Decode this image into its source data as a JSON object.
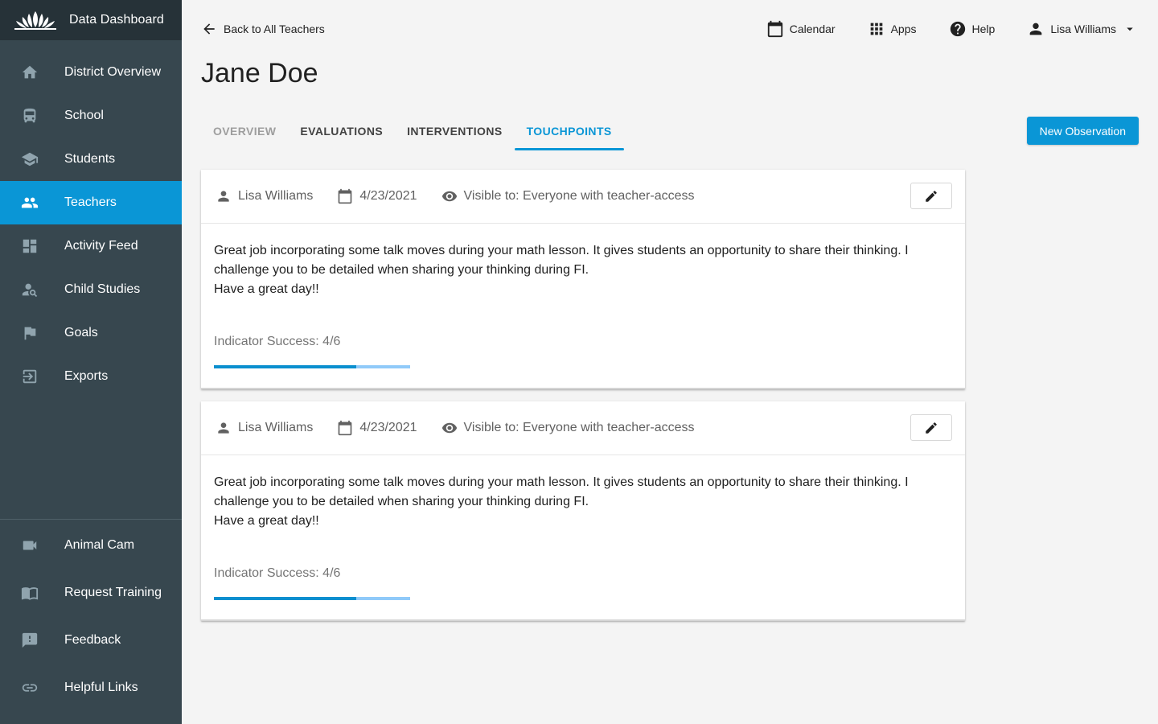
{
  "app": {
    "title": "Data Dashboard"
  },
  "sidebar": {
    "items": [
      {
        "label": "District Overview",
        "icon": "home-icon"
      },
      {
        "label": "School",
        "icon": "bus-icon"
      },
      {
        "label": "Students",
        "icon": "graduation-cap-icon"
      },
      {
        "label": "Teachers",
        "icon": "people-icon",
        "active": true
      },
      {
        "label": "Activity Feed",
        "icon": "dashboard-icon"
      },
      {
        "label": "Child Studies",
        "icon": "person-search-icon"
      },
      {
        "label": "Goals",
        "icon": "flag-icon"
      },
      {
        "label": "Exports",
        "icon": "exit-icon"
      }
    ],
    "bottom_items": [
      {
        "label": "Animal Cam",
        "icon": "video-camera-icon"
      },
      {
        "label": "Request Training",
        "icon": "book-icon"
      },
      {
        "label": "Feedback",
        "icon": "feedback-icon"
      },
      {
        "label": "Helpful Links",
        "icon": "link-icon"
      }
    ]
  },
  "header": {
    "back_label": "Back to All Teachers",
    "calendar_label": "Calendar",
    "apps_label": "Apps",
    "help_label": "Help",
    "user_name": "Lisa Williams"
  },
  "page": {
    "title": "Jane Doe",
    "tabs": [
      {
        "label": "OVERVIEW",
        "state": "muted"
      },
      {
        "label": "EVALUATIONS",
        "state": "normal"
      },
      {
        "label": "INTERVENTIONS",
        "state": "normal"
      },
      {
        "label": "TOUCHPOINTS",
        "state": "active"
      }
    ],
    "new_observation_label": "New Observation"
  },
  "touchpoints": [
    {
      "author": "Lisa Williams",
      "date": "4/23/2021",
      "visibility": "Visible to: Everyone with teacher-access",
      "body_line1": "Great job incorporating some talk moves during your math lesson. It gives students an opportunity to share their thinking. I",
      "body_line2": "challenge you to be detailed when sharing your thinking during FI.",
      "body_line3": "Have a great day!!",
      "indicator_label": "Indicator Success: 4/6",
      "indicator_progress": 0.7246
    },
    {
      "author": "Lisa Williams",
      "date": "4/23/2021",
      "visibility": "Visible to: Everyone with teacher-access",
      "body_line1": "Great job incorporating some talk moves during your math lesson. It gives students an opportunity to share their thinking. I",
      "body_line2": "challenge you to be detailed when sharing your thinking during FI.",
      "body_line3": "Have a great day!!",
      "indicator_label": "Indicator Success: 4/6",
      "indicator_progress": 0.7246
    }
  ],
  "colors": {
    "accent": "#0a96d6",
    "sidebar": "#37474f",
    "sidebar_header": "#263238"
  }
}
